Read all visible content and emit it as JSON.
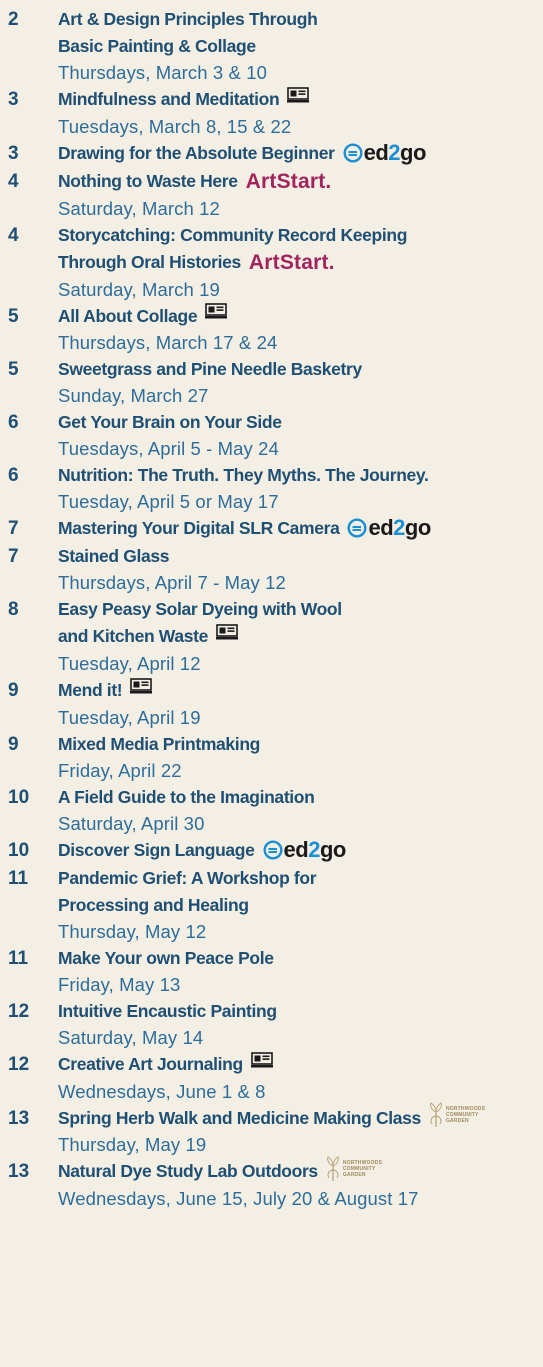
{
  "badge_text": {
    "ed2go_prefix": "ed",
    "ed2go_two": "2",
    "ed2go_suffix": "go",
    "artstart": "ArtStart.",
    "garden_line1": "NORTHWOODS",
    "garden_line2": "COMMUNITY",
    "garden_line3": "GARDEN"
  },
  "colors": {
    "title": "#1f4f72",
    "date": "#2f6d99",
    "artstart": "#a3235c",
    "ed2go_accent": "#1a8fd1",
    "background": "#f3efe5"
  },
  "entries": [
    {
      "page": "2",
      "title": [
        "Art & Design Principles Through",
        "Basic Painting & Collage"
      ],
      "date": "Thursdays, March 3 & 10",
      "badge": null
    },
    {
      "page": "3",
      "title": [
        "Mindfulness and Meditation"
      ],
      "date": "Tuesdays, March 8, 15 & 22",
      "badge": "online"
    },
    {
      "page": "3",
      "title": [
        "Drawing for the Absolute Beginner"
      ],
      "date": null,
      "badge": "ed2go"
    },
    {
      "page": "4",
      "title": [
        "Nothing to Waste Here"
      ],
      "date": "Saturday, March 12",
      "badge": "artstart"
    },
    {
      "page": "4",
      "title": [
        "Storycatching: Community Record Keeping",
        "Through Oral Histories"
      ],
      "date": "Saturday, March 19",
      "badge": "artstart"
    },
    {
      "page": "5",
      "title": [
        "All About Collage"
      ],
      "date": "Thursdays, March 17 & 24",
      "badge": "online"
    },
    {
      "page": "5",
      "title": [
        "Sweetgrass and Pine Needle Basketry"
      ],
      "date": "Sunday, March 27",
      "badge": null
    },
    {
      "page": "6",
      "title": [
        "Get Your Brain on Your Side"
      ],
      "date": "Tuesdays, April 5 - May 24",
      "badge": null
    },
    {
      "page": "6",
      "title": [
        "Nutrition: The Truth. They Myths. The Journey."
      ],
      "date": "Tuesday, April 5 or May 17",
      "badge": null
    },
    {
      "page": "7",
      "title": [
        "Mastering Your Digital SLR Camera"
      ],
      "date": null,
      "badge": "ed2go"
    },
    {
      "page": "7",
      "title": [
        "Stained Glass"
      ],
      "date": "Thursdays, April 7 - May 12",
      "badge": null
    },
    {
      "page": "8",
      "title": [
        "Easy Peasy Solar Dyeing with Wool",
        "and Kitchen Waste"
      ],
      "date": "Tuesday, April 12",
      "badge": "online"
    },
    {
      "page": "9",
      "title": [
        "Mend it!"
      ],
      "date": "Tuesday, April 19",
      "badge": "online"
    },
    {
      "page": "9",
      "title": [
        "Mixed Media Printmaking"
      ],
      "date": "Friday, April 22",
      "badge": null
    },
    {
      "page": "10",
      "title": [
        "A Field Guide to the Imagination"
      ],
      "date": "Saturday, April 30",
      "badge": null
    },
    {
      "page": "10",
      "title": [
        "Discover Sign Language"
      ],
      "date": null,
      "badge": "ed2go"
    },
    {
      "page": "11",
      "title": [
        "Pandemic Grief: A Workshop for",
        "Processing and Healing"
      ],
      "date": "Thursday, May 12",
      "badge": null
    },
    {
      "page": "11",
      "title": [
        "Make Your own Peace Pole"
      ],
      "date": "Friday, May 13",
      "badge": null
    },
    {
      "page": "12",
      "title": [
        "Intuitive Encaustic Painting"
      ],
      "date": "Saturday, May 14",
      "badge": null
    },
    {
      "page": "12",
      "title": [
        "Creative Art Journaling"
      ],
      "date": "Wednesdays, June 1 & 8",
      "badge": "online"
    },
    {
      "page": "13",
      "title": [
        "Spring Herb Walk and Medicine Making Class"
      ],
      "date": "Thursday, May 19",
      "badge": "garden"
    },
    {
      "page": "13",
      "title": [
        "Natural Dye Study Lab Outdoors"
      ],
      "date": "Wednesdays, June 15, July 20 & August 17",
      "badge": "garden"
    }
  ]
}
